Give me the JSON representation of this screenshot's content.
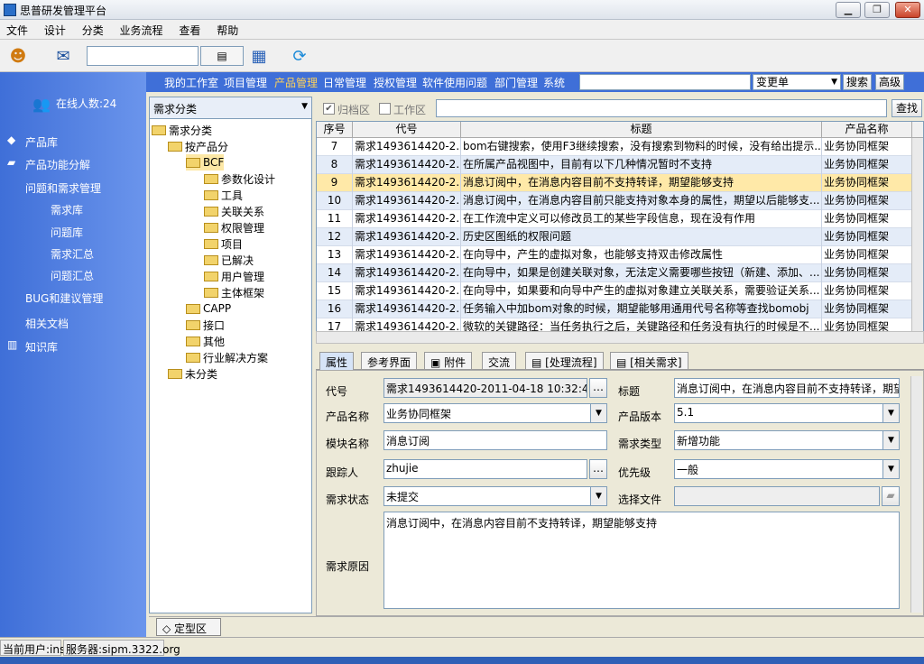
{
  "window": {
    "title": "思普研发管理平台",
    "minimize": "▁",
    "restore": "❐",
    "close": "✕"
  },
  "menu": [
    "文件",
    "设计",
    "分类",
    "业务流程",
    "查看",
    "帮助"
  ],
  "toolbar": {
    "search_value": "",
    "picker_label": "▤"
  },
  "nav": {
    "links": [
      "我的工作室",
      "项目管理",
      "产品管理",
      "日常管理",
      "授权管理",
      "软件使用问题",
      "部门管理",
      "系统"
    ],
    "active_index": 2,
    "search_value": "",
    "select_value": "变更单",
    "search_button": "搜索",
    "advanced_button": "高级"
  },
  "left": {
    "online": "在线人数:24",
    "items": [
      "产品库",
      "产品功能分解",
      "问题和需求管理",
      "需求库",
      "问题库",
      "需求汇总",
      "问题汇总",
      "BUG和建议管理",
      "相关文档",
      "知识库"
    ]
  },
  "tree": {
    "select_value": "需求分类",
    "nodes": [
      "需求分类",
      "按产品分",
      "BCF",
      "参数化设计",
      "工具",
      "关联关系",
      "权限管理",
      "项目",
      "已解决",
      "用户管理",
      "主体框架",
      "CAPP",
      "接口",
      "其他",
      "行业解决方案",
      "未分类"
    ],
    "tab": "定型区"
  },
  "filter": {
    "archive": "归档区",
    "work": "工作区",
    "query_button": "查找"
  },
  "table": {
    "columns": [
      "序号",
      "代号",
      "标题",
      "产品名称"
    ],
    "rows": [
      [
        "7",
        "需求1493614420-2...",
        "bom右键搜索，使用F3继续搜索，没有搜索到物料的时候，没有给出提示...",
        "业务协同框架"
      ],
      [
        "8",
        "需求1493614420-2...",
        "在所属产品视图中，目前有以下几种情况暂时不支持",
        "业务协同框架"
      ],
      [
        "9",
        "需求1493614420-2...",
        "消息订阅中，在消息内容目前不支持转译，期望能够支持",
        "业务协同框架"
      ],
      [
        "10",
        "需求1493614420-2...",
        "消息订阅中，在消息内容目前只能支持对象本身的属性，期望以后能够支...",
        "业务协同框架"
      ],
      [
        "11",
        "需求1493614420-2...",
        "在工作流中定义可以修改员工的某些字段信息，现在没有作用",
        "业务协同框架"
      ],
      [
        "12",
        "需求1493614420-2...",
        "历史区图纸的权限问题",
        "业务协同框架"
      ],
      [
        "13",
        "需求1493614420-2...",
        "在向导中，产生的虚拟对象，也能够支持双击修改属性",
        "业务协同框架"
      ],
      [
        "14",
        "需求1493614420-2...",
        "在向导中，如果是创建关联对象，无法定义需要哪些按钮（新建、添加、...",
        "业务协同框架"
      ],
      [
        "15",
        "需求1493614420-2...",
        "在向导中，如果要和向导中产生的虚拟对象建立关联关系，需要验证关系...",
        "业务协同框架"
      ],
      [
        "16",
        "需求1493614420-2...",
        "任务输入中加bom对象的时候，期望能够用通用代号名称等查找bomobj",
        "业务协同框架"
      ],
      [
        "17",
        "需求1493614420-2...",
        "微软的关键路径：当任务执行之后，关键路径和任务没有执行的时候是不...",
        "业务协同框架"
      ]
    ],
    "selected_index": 2
  },
  "prop_tabs": [
    "属性",
    "参考界面",
    "附件",
    "交流",
    "[处理流程]",
    "[相关需求]"
  ],
  "form": {
    "code_label": "代号",
    "code_value": "需求1493614420-2011-04-18 10:32:42",
    "title_label": "标题",
    "title_value": "消息订阅中，在消息内容目前不支持转译，期望",
    "product_label": "产品名称",
    "product_value": "业务协同框架",
    "version_label": "产品版本",
    "version_value": "5.1",
    "module_label": "模块名称",
    "module_value": "消息订阅",
    "type_label": "需求类型",
    "type_value": "新增功能",
    "tracker_label": "跟踪人",
    "tracker_value": "zhujie",
    "priority_label": "优先级",
    "priority_value": "一般",
    "status_label": "需求状态",
    "status_value": "未提交",
    "file_label": "选择文件",
    "file_value": "",
    "reason_label": "需求原因",
    "reason_value": "消息订阅中，在消息内容目前不支持转译，期望能够支持"
  },
  "status": {
    "user": "当前用户:ins",
    "server": "服务器:sipm.3322.org"
  }
}
